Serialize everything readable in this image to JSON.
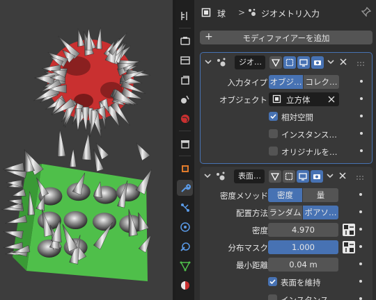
{
  "breadcrumb": {
    "object": "球",
    "separator": ">",
    "modifier": "ジオメトリ入力"
  },
  "add_modifier_label": "モディファイアーを追加",
  "modifier1": {
    "name": "ジオ…",
    "input_type": {
      "label": "入力タイプ",
      "options": [
        "オブジ…",
        "コレク…"
      ],
      "selected": "オブジ…"
    },
    "object": {
      "label": "オブジェクト",
      "value": "立方体"
    },
    "checks": [
      {
        "label": "相対空間",
        "checked": true
      },
      {
        "label": "インスタンス…",
        "checked": false
      },
      {
        "label": "オリジナルを…",
        "checked": false
      }
    ]
  },
  "modifier2": {
    "name": "表面…",
    "distribute_method": {
      "label": "密度メソッド",
      "options": [
        "密度",
        "量"
      ],
      "selected": "密度"
    },
    "placement": {
      "label": "配置方法",
      "options": [
        "ランダム",
        "ポアソ…"
      ],
      "selected": "ポアソ…"
    },
    "density": {
      "label": "密度",
      "value": "4.970"
    },
    "mask": {
      "label": "分布マスク",
      "value": "1.000"
    },
    "min_distance": {
      "label": "最小距離",
      "value": "0.04 m"
    },
    "keep_surface": {
      "label": "表面を維持",
      "checked": true
    },
    "instance": {
      "label": "インスタンス…",
      "checked": false
    }
  },
  "colors": {
    "accent": "#4772b3",
    "sphere": "#c93030",
    "cube": "#4fbf4a"
  }
}
